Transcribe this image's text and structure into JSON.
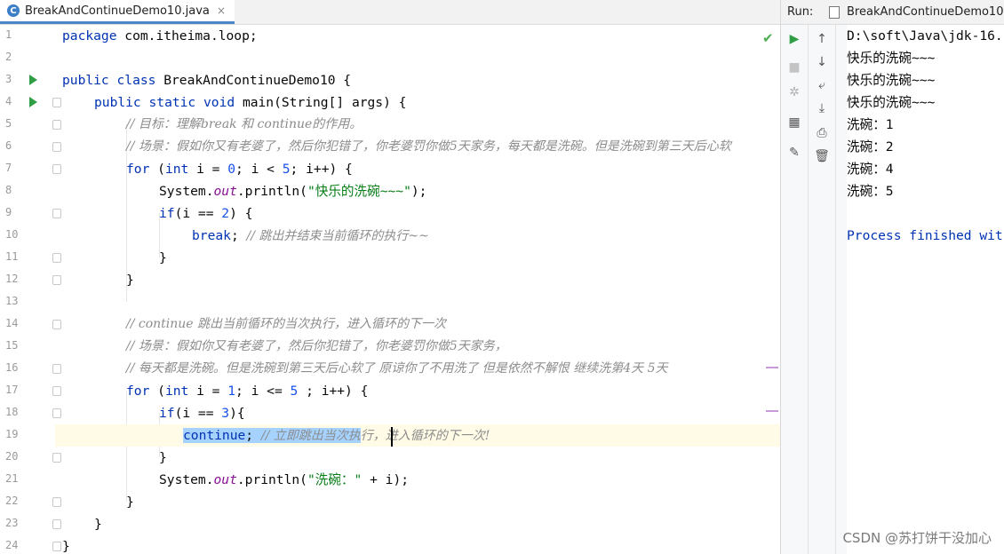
{
  "tab": {
    "file_name": "BreakAndContinueDemo10.java",
    "close": "×"
  },
  "gutter": {
    "line_numbers": [
      "1",
      "2",
      "3",
      "4",
      "5",
      "6",
      "7",
      "8",
      "9",
      "10",
      "11",
      "12",
      "13",
      "14",
      "15",
      "16",
      "17",
      "18",
      "19",
      "20",
      "21",
      "22",
      "23",
      "24"
    ]
  },
  "code": {
    "l1_pkg": "package",
    "l1_rest": " com.itheima.loop;",
    "l3_kw": "public class",
    "l3_rest": " BreakAndContinueDemo10 {",
    "l4_kw": "public static void",
    "l4_rest": " main(String[] args) {",
    "l5": "// 目标：理解break 和 continue的作用。",
    "l6": "// 场景：假如你又有老婆了，然后你犯错了，你老婆罚你做5天家务，每天都是洗碗。但是洗碗到第三天后心软",
    "l7_for": "for",
    "l7_a": " (",
    "l7_int": "int",
    "l7_b": " i = ",
    "l7_n0": "0",
    "l7_c": "; i < ",
    "l7_n5": "5",
    "l7_d": "; i++) {",
    "l8_a": "System.",
    "l8_out": "out",
    "l8_b": ".println(",
    "l8_str": "\"快乐的洗碗~~~\"",
    "l8_c": ");",
    "l9_if": "if",
    "l9_a": "(i == ",
    "l9_n": "2",
    "l9_b": ") {",
    "l10_break": "break",
    "l10_semi": "; ",
    "l10_cmt": "// 跳出并结束当前循环的执行~~",
    "brace_close": "}",
    "l14": "// continue 跳出当前循环的当次执行，进入循环的下一次",
    "l15": "// 场景：假如你又有老婆了，然后你犯错了，你老婆罚你做5天家务，",
    "l16": "// 每天都是洗碗。但是洗碗到第三天后心软了 原谅你了不用洗了 但是依然不解恨 继续洗第4天 5天",
    "l17_for": "for",
    "l17_a": " (",
    "l17_int": "int",
    "l17_b": " i = ",
    "l17_n1": "1",
    "l17_c": "; i <= ",
    "l17_n5": "5",
    "l17_d": " ; i++) {",
    "l18_if": "if",
    "l18_a": "(i == ",
    "l18_n": "3",
    "l18_b": "){",
    "l19_continue": "continue",
    "l19_semi": "; ",
    "l19_cmt_sel": "// 立即跳出当次执",
    "l19_cmt_rest": "行，进入循环的下一次!",
    "l21_a": "System.",
    "l21_out": "out",
    "l21_b": ".println(",
    "l21_str": "\"洗碗：\"",
    "l21_c": " + i);"
  },
  "run_panel": {
    "label": "Run:",
    "tab_name": "BreakAndContinueDemo10",
    "output": [
      "D:\\soft\\Java\\jdk-16.",
      "快乐的洗碗~~~",
      "快乐的洗碗~~~",
      "快乐的洗碗~~~",
      "洗碗：1",
      "洗碗：2",
      "洗碗：4",
      "洗碗：5",
      "",
      "Process finished wit"
    ]
  },
  "watermark": "CSDN @苏打饼干没加心",
  "colors": {
    "keyword": "#0033b3",
    "string": "#067d17",
    "comment": "#8c8c8c",
    "field": "#871094",
    "number": "#1750eb",
    "selection": "#a6d2ff"
  }
}
